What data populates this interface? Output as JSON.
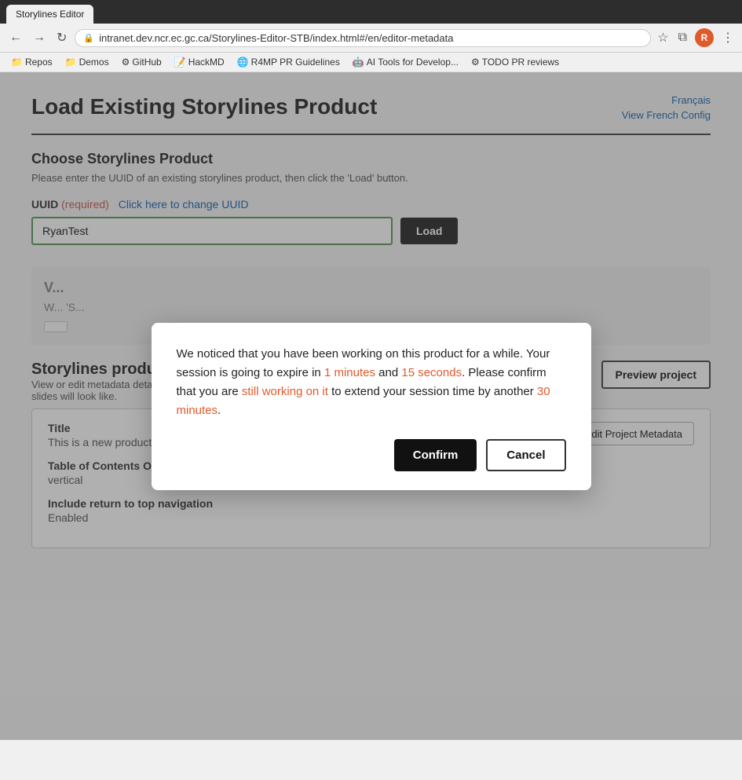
{
  "browser": {
    "tabs": [
      {
        "label": "Storylines Editor",
        "active": true
      }
    ],
    "address": "intranet.dev.ncr.ec.gc.ca/Storylines-Editor-STB/index.html#/en/editor-metadata",
    "nav_back_disabled": false,
    "nav_forward_disabled": false
  },
  "bookmarks": [
    {
      "icon": "📁",
      "label": "Repos"
    },
    {
      "icon": "📁",
      "label": "Demos"
    },
    {
      "icon": "⚙",
      "label": "GitHub"
    },
    {
      "icon": "📝",
      "label": "HackMD"
    },
    {
      "icon": "🌐",
      "label": "R4MP PR Guidelines"
    },
    {
      "icon": "🤖",
      "label": "AI Tools for Develop..."
    },
    {
      "icon": "⚙",
      "label": "TODO PR reviews"
    }
  ],
  "page": {
    "title": "Load Existing Storylines Product",
    "lang_link": "Français",
    "french_config_link": "View French Config"
  },
  "choose_section": {
    "title": "Choose Storylines Product",
    "description": "Please enter the UUID of an existing storylines product, then click the 'Load' button.",
    "uuid_label": "UUID",
    "uuid_required": "(required)",
    "uuid_change_link": "Click here to change UUID",
    "uuid_value": "RyanTest",
    "load_button": "Load"
  },
  "version_section": {
    "title": "V...",
    "description": "W... 'S...",
    "button_label": ""
  },
  "product_details": {
    "title": "Storylines product details",
    "description": "View or edit metadata details about your Storylines product. Use the \"Preview\" button to see what your slides will look like.",
    "preview_button": "Preview project",
    "edit_button": "Edit Project Metadata",
    "fields": [
      {
        "label": "Title",
        "value": "This is a new product"
      },
      {
        "label": "Table of Contents Orientation",
        "value": "vertical"
      },
      {
        "label": "Include return to top navigation",
        "value": "Enabled"
      },
      {
        "label": "...",
        "value": "..."
      }
    ]
  },
  "modal": {
    "message_parts": [
      {
        "text": "We noticed that you have been working on this product for a while. Your session is going to expire in ",
        "highlight": false
      },
      {
        "text": "1 minutes",
        "highlight": true
      },
      {
        "text": " and ",
        "highlight": false
      },
      {
        "text": "15 seconds",
        "highlight": true
      },
      {
        "text": ". Please confirm that you are ",
        "highlight": false
      },
      {
        "text": "still working on it",
        "highlight": true
      },
      {
        "text": " to extend your session time by another ",
        "highlight": false
      },
      {
        "text": "30 minutes",
        "highlight": true
      },
      {
        "text": ".",
        "highlight": false
      }
    ],
    "confirm_label": "Confirm",
    "cancel_label": "Cancel"
  }
}
